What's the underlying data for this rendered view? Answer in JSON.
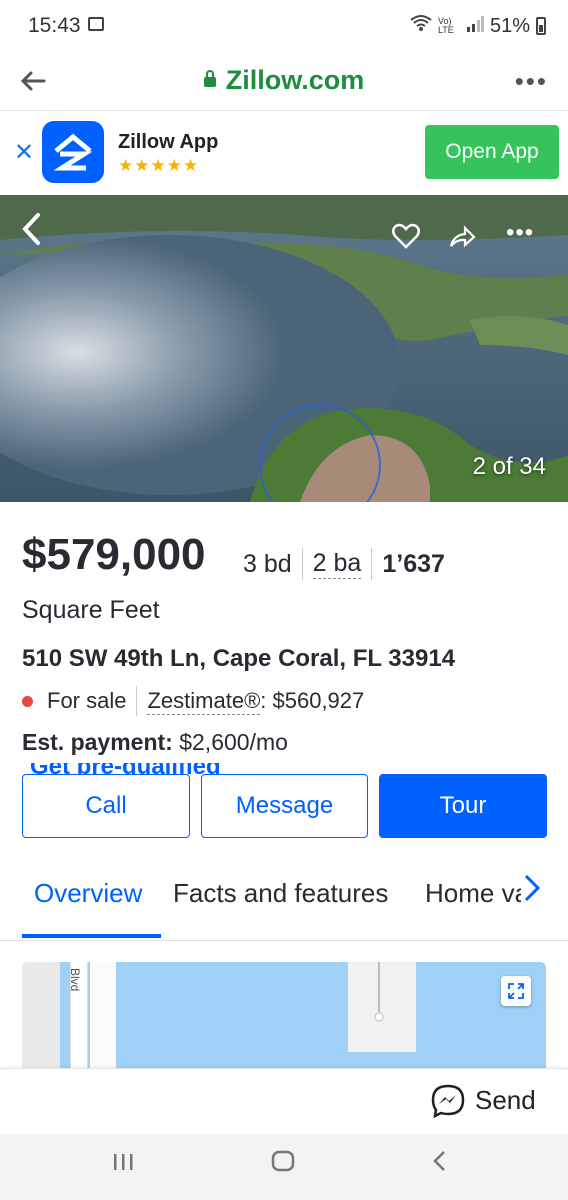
{
  "status_bar": {
    "time": "15:43",
    "network": "Vo) LTE",
    "battery": "51%"
  },
  "browser": {
    "url": "Zillow.com"
  },
  "app_banner": {
    "title": "Zillow App",
    "stars": "★★★★★",
    "open_label": "Open App"
  },
  "gallery": {
    "counter": "2 of 34"
  },
  "listing": {
    "price": "$579,000",
    "beds": "3 bd",
    "baths": "2 ba",
    "sqft": "1’637",
    "sqft_label": "Square Feet",
    "address": "510 SW 49th Ln, Cape Coral, FL 33914",
    "status": "For sale",
    "zestimate_label": "Zestimate®",
    "zestimate_value": ": $560,927",
    "est_payment_label": "Est. payment:",
    "est_payment_value": " $2,600/mo",
    "partial_text": "Get pre-qualified"
  },
  "actions": {
    "call": "Call",
    "message": "Message",
    "tour": "Tour"
  },
  "tabs": [
    "Overview",
    "Facts and features",
    "Home value"
  ],
  "map": {
    "road_label": "Blvd"
  },
  "send_bar": {
    "send_label": "Send"
  },
  "colors": {
    "brand_blue": "#0061ff",
    "green": "#35c45b",
    "for_sale_dot": "#e8483f"
  }
}
